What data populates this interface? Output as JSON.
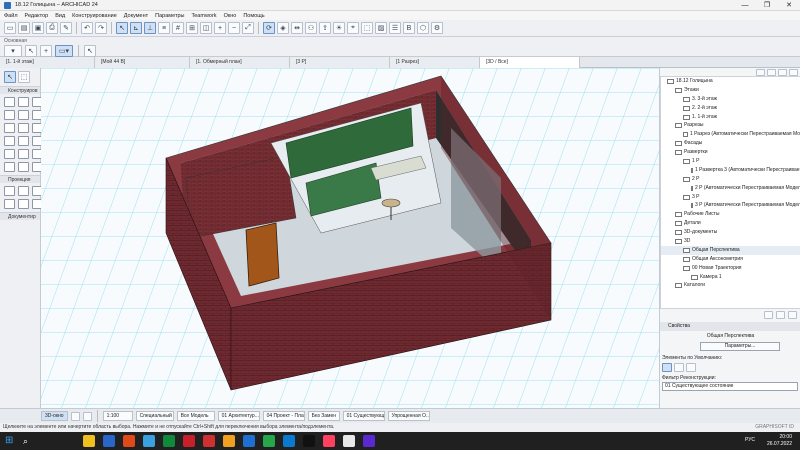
{
  "window": {
    "title": "18.12 Голицына – ARCHICAD 24",
    "controls": [
      "—",
      "❐",
      "✕"
    ]
  },
  "menu": [
    "Файл",
    "Редактор",
    "Вид",
    "Конструирование",
    "Документ",
    "Параметры",
    "Teamwork",
    "Окно",
    "Помощь"
  ],
  "infobox": {
    "label": "Основная"
  },
  "view_tabs": [
    "[1. 1-й этаж]",
    "[Мой 44 В]",
    "[1. Обмерный план]",
    "[3 Р]",
    "[1 Разрез]",
    "[3D / Все]"
  ],
  "left_palette": {
    "sections": [
      "Конструиров",
      "Проекция",
      "Документир"
    ]
  },
  "navigator": {
    "items": [
      {
        "label": "18.12 Голицына",
        "indent": 0
      },
      {
        "label": "Этажи",
        "indent": 1
      },
      {
        "label": "3. 3-й этаж",
        "indent": 2
      },
      {
        "label": "2. 2-й этаж",
        "indent": 2
      },
      {
        "label": "1. 1-й этаж",
        "indent": 2
      },
      {
        "label": "Разрезы",
        "indent": 1
      },
      {
        "label": "1 Разрез (Автоматически Перестраиваемая Мо",
        "indent": 2
      },
      {
        "label": "Фасады",
        "indent": 1
      },
      {
        "label": "Развертки",
        "indent": 1
      },
      {
        "label": "1 Р",
        "indent": 2
      },
      {
        "label": "1 Развертка 3 (Автоматически Перестраиваем",
        "indent": 3
      },
      {
        "label": "2 Р",
        "indent": 2
      },
      {
        "label": "2 Р (Автоматически Перестраиваемая Модел",
        "indent": 3
      },
      {
        "label": "3 Р",
        "indent": 2
      },
      {
        "label": "3 Р (Автоматически Перестраиваемая Модел",
        "indent": 3
      },
      {
        "label": "Рабочие Листы",
        "indent": 1
      },
      {
        "label": "Детали",
        "indent": 1
      },
      {
        "label": "3D-документы",
        "indent": 1
      },
      {
        "label": "3D",
        "indent": 1
      },
      {
        "label": "Общая Перспектива",
        "indent": 2,
        "selected": true
      },
      {
        "label": "Общая Аксонометрия",
        "indent": 2
      },
      {
        "label": "00 Новая Траектория",
        "indent": 2
      },
      {
        "label": "Камера 1",
        "indent": 3
      },
      {
        "label": "Каталоги",
        "indent": 1
      }
    ]
  },
  "properties": {
    "header": "Свойства",
    "name": "Общая Перспектива",
    "params_button": "Параметры...",
    "defaults_label": "Элементы по Умолчанию:",
    "filter_label": "Фильтр Реконструкции:",
    "filter_value": "01 Существующее состояние"
  },
  "status": {
    "view_label": "3D-окно",
    "scale": "1:100",
    "special": "Специальный",
    "model": "Все Модель",
    "arch": "01 Архитектур...",
    "project": "04 Проект - Пла...",
    "no_overrides": "Без Замен",
    "existing": "01 Существующ...",
    "simplified": "Упрощенная О..."
  },
  "hint": "Щелкните на элементе или начертите область выбора. Нажмите и не отпускайте Ctrl+Shift для переключения выбора элемента/подэлемента.",
  "graphisoft_label": "GRAPHISOFT ID",
  "taskbar": {
    "time": "20:00",
    "date": "26.07.2022",
    "lang": "РУС",
    "apps": [
      "#f0c020",
      "#2a66c8",
      "#e04a1a",
      "#3aa0e0",
      "#0f8a3a",
      "#c8202a",
      "#d03030",
      "#f2a020",
      "#1f6fd0",
      "#25a84a",
      "#0a7ad0",
      "#111111",
      "#ff4060",
      "#e8e8e8",
      "#5a2ad0"
    ]
  }
}
